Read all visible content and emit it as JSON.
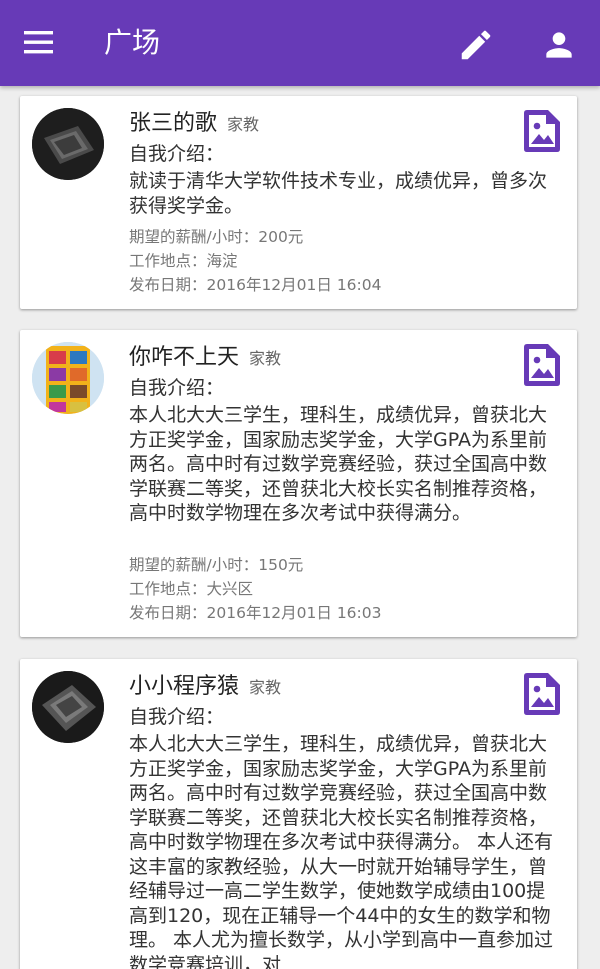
{
  "appbar": {
    "title": "广场"
  },
  "icons": {
    "menu": "menu-icon",
    "edit": "edit-pencil-icon",
    "account": "person-icon",
    "image": "image-icon"
  },
  "colors": {
    "primary": "#673ab7",
    "background": "#eeeeee"
  },
  "posts": [
    {
      "name": "张三的歌",
      "tag": "家教",
      "intro_label": "自我介绍：",
      "intro": "就读于清华大学软件技术专业，成绩优异，曾多次获得奖学金。",
      "salary": "期望的薪酬/小时：200元",
      "location": "工作地点：海淀",
      "date": "发布日期：2016年12月01日  16:04"
    },
    {
      "name": "你咋不上天",
      "tag": "家教",
      "intro_label": "自我介绍：",
      "intro": "本人北大大三学生，理科生，成绩优异，曾获北大方正奖学金，国家励志奖学金，大学GPA为系里前两名。高中时有过数学竞赛经验，获过全国高中数学联赛二等奖，还曾获北大校长实名制推荐资格，高中时数学物理在多次考试中获得满分。",
      "salary": "期望的薪酬/小时：150元",
      "location": "工作地点：大兴区",
      "date": "发布日期：2016年12月01日  16:03"
    },
    {
      "name": "小小程序猿",
      "tag": "家教",
      "intro_label": "自我介绍：",
      "intro": "本人北大大三学生，理科生，成绩优异，曾获北大方正奖学金，国家励志奖学金，大学GPA为系里前两名。高中时有过数学竞赛经验，获过全国高中数学联赛二等奖，还曾获北大校长实名制推荐资格，高中时数学物理在多次考试中获得满分。 本人还有这丰富的家教经验，从大一时就开始辅导学生，曾经辅导过一高二学生数学，使她数学成绩由100提高到120，现在正辅导一个44中的女生的数学和物理。 本人尤为擅长数学，从小学到高中一直参加过数学竞赛培训，对"
    }
  ]
}
